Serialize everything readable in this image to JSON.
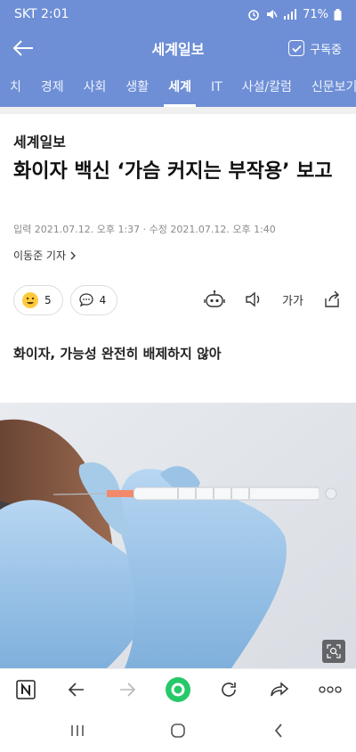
{
  "status_bar": {
    "carrier_time": "SKT 2:01",
    "battery": "71%"
  },
  "app_bar": {
    "title": "세계일보",
    "subscribe_label": "구독중"
  },
  "tabs": [
    "치",
    "경제",
    "사회",
    "생활",
    "세계",
    "IT",
    "사설/칼럼",
    "신문보기"
  ],
  "active_tab": "세계",
  "article": {
    "publisher": "세계일보",
    "headline": "화이자 백신 ‘가슴 커지는 부작용’ 보고",
    "dates": "입력 2021.07.12. 오후 1:37 · 수정 2021.07.12. 오후 1:40",
    "reporter": "이동준 기자",
    "reactions": {
      "emoji_count": "5",
      "comment_count": "4"
    },
    "font_size_label": "가가",
    "subheadline": "화이자, 가능성 완전히 배제하지 않아"
  },
  "colors": {
    "brand": "#6e8fd6",
    "glove": "#9ec4e6",
    "accent_green": "#27c86a"
  }
}
